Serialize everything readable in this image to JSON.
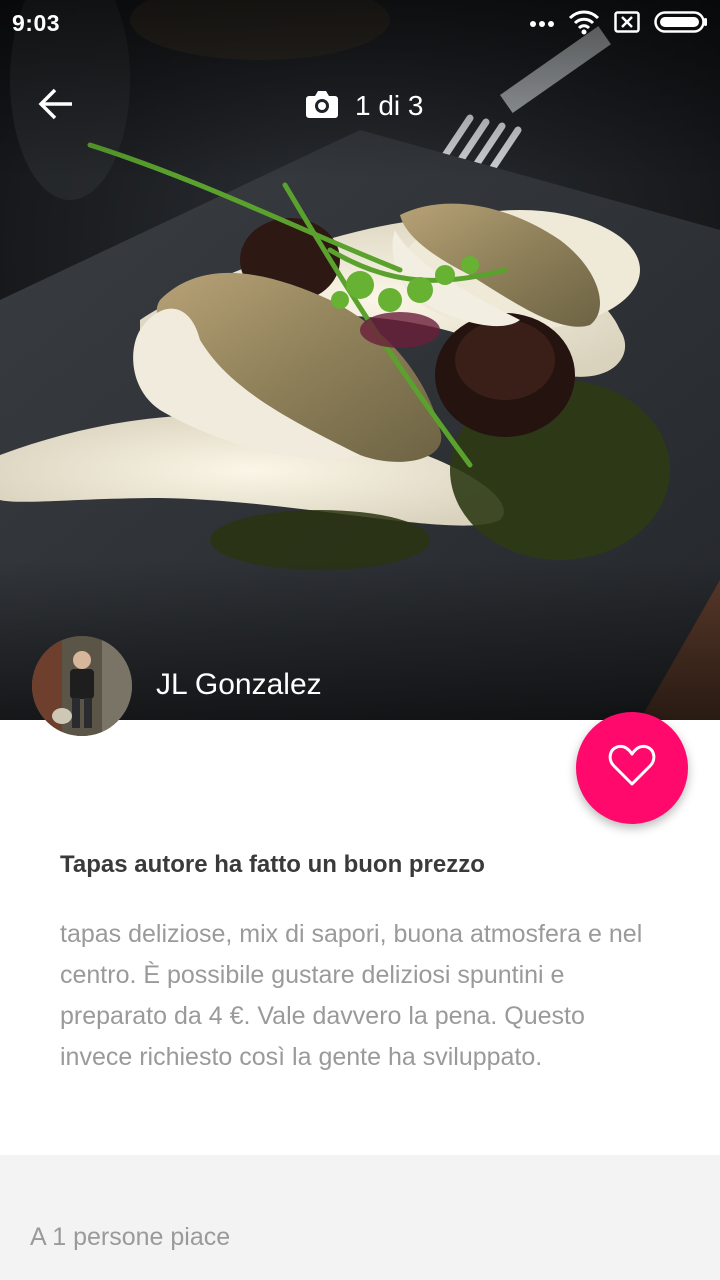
{
  "status_bar": {
    "time": "9:03"
  },
  "gallery": {
    "back_icon": "arrow-left-icon",
    "camera_icon": "camera-icon",
    "counter": "1 di 3"
  },
  "author": {
    "name": "JL Gonzalez"
  },
  "like_button": {
    "icon": "heart-outline-icon",
    "color": "#ff0a6c"
  },
  "review": {
    "title": "Tapas autore ha fatto un buon prezzo",
    "body": "tapas deliziose, mix di sapori, buona atmosfera e nel centro. È possibile gustare deliziosi spuntini e preparato da 4 €. Vale davvero la pena. Questo invece richiesto così la gente ha sviluppato."
  },
  "footer": {
    "likes_text": "A 1 persone piace"
  }
}
